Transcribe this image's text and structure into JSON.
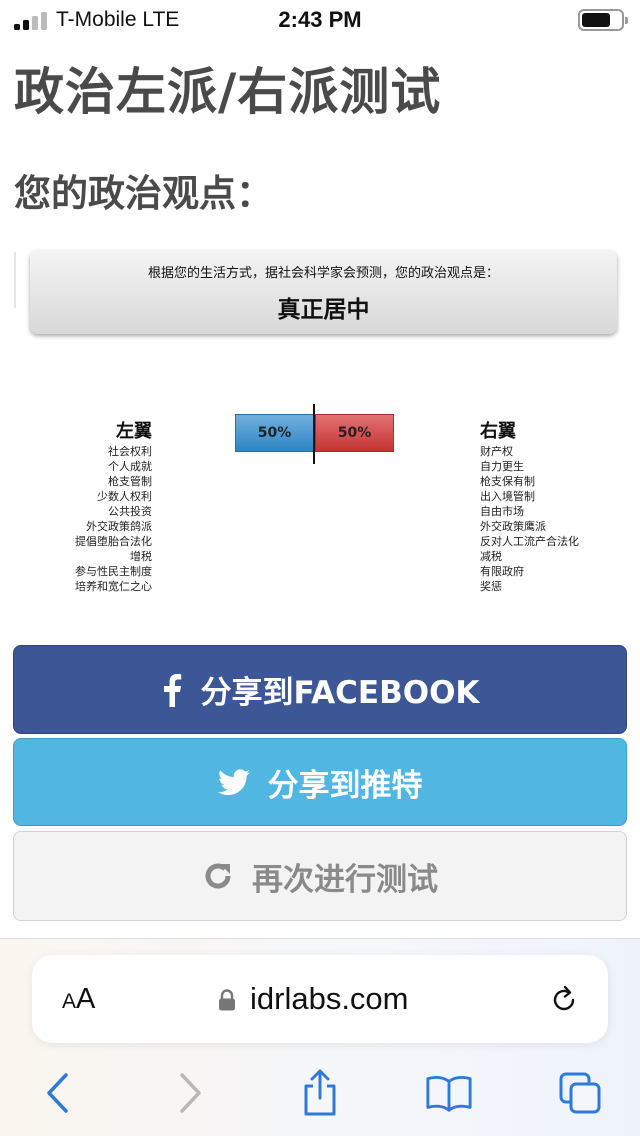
{
  "status_bar": {
    "carrier": "T-Mobile  LTE",
    "time": "2:43 PM"
  },
  "page": {
    "title": "政治左派/右派测试",
    "section_title": "您的政治观点："
  },
  "result": {
    "subtitle": "根据您的生活方式，据社会科学家会预测，您的政治观点是：",
    "value": "真正居中"
  },
  "spectrum": {
    "left_percent": 50,
    "right_percent": 50,
    "left_label": "50%",
    "right_label": "50%",
    "left_color": "#2f86c4",
    "right_color": "#c63434",
    "left": {
      "heading": "左翼",
      "items": [
        "社会权利",
        "个人成就",
        "枪支管制",
        "少数人权利",
        "公共投资",
        "外交政策鸽派",
        "提倡堕胎合法化",
        "增税",
        "参与性民主制度",
        "培养和宽仁之心"
      ]
    },
    "right": {
      "heading": "右翼",
      "items": [
        "财产权",
        "自力更生",
        "枪支保有制",
        "出入境管制",
        "自由市场",
        "外交政策鹰派",
        "反对人工流产合法化",
        "减税",
        "有限政府",
        "奖惩"
      ]
    }
  },
  "buttons": {
    "facebook": {
      "label": "分享到FACEBOOK",
      "icon": "facebook-icon",
      "color": "#3c5696"
    },
    "twitter": {
      "label": "分享到推特",
      "icon": "twitter-icon",
      "color": "#52b6e3"
    },
    "retry": {
      "label": "再次进行测试",
      "icon": "refresh-icon",
      "color": "#f3f3f3"
    }
  },
  "browser": {
    "text_size_small": "A",
    "text_size_big": "A",
    "url": "idrlabs.com",
    "accent_color": "#2f7ad9"
  }
}
